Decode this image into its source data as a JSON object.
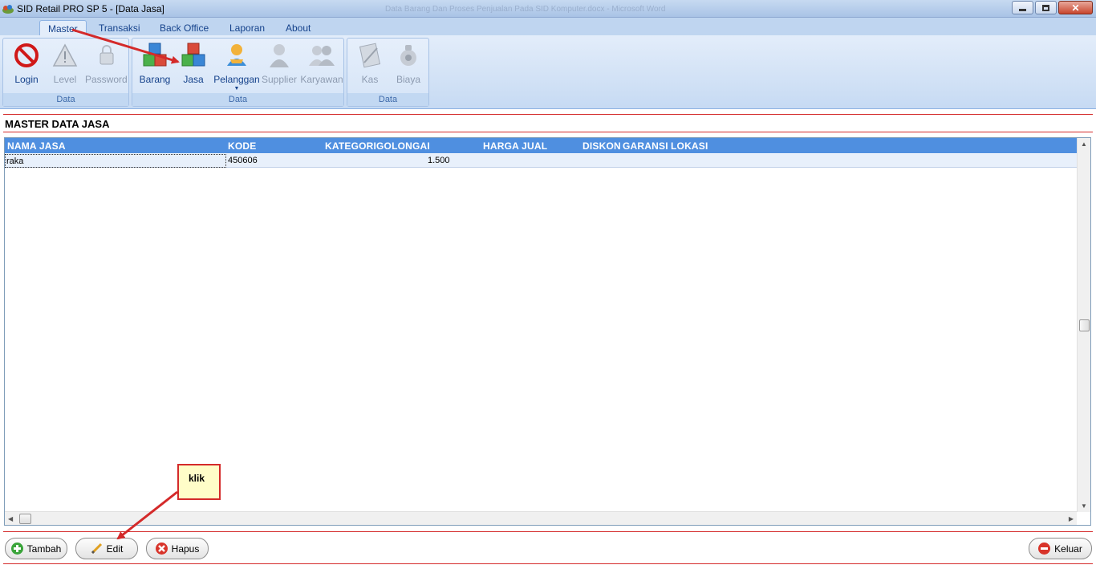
{
  "window": {
    "title": "SID Retail PRO SP 5 - [Data Jasa]",
    "background_ghost_text": "Data Barang Dan Proses Penjualan Pada SID Komputer.docx - Microsoft Word"
  },
  "ribbon": {
    "tabs": [
      {
        "label": "Master",
        "active": true
      },
      {
        "label": "Transaksi"
      },
      {
        "label": "Back Office"
      },
      {
        "label": "Laporan"
      },
      {
        "label": "About"
      }
    ],
    "groups": [
      {
        "label": "Data",
        "buttons": [
          {
            "label": "Login",
            "icon": "no-entry-icon",
            "enabled": true
          },
          {
            "label": "Level",
            "icon": "warning-icon",
            "enabled": false
          },
          {
            "label": "Password",
            "icon": "lock-icon",
            "enabled": false
          }
        ]
      },
      {
        "label": "Data",
        "buttons": [
          {
            "label": "Barang",
            "icon": "cubes-icon",
            "enabled": true
          },
          {
            "label": "Jasa",
            "icon": "cubes-red-icon",
            "enabled": true
          },
          {
            "label": "Pelanggan",
            "icon": "customer-icon",
            "enabled": true
          },
          {
            "label": "Supplier",
            "icon": "supplier-icon",
            "enabled": false
          },
          {
            "label": "Karyawan",
            "icon": "employees-icon",
            "enabled": false
          }
        ]
      },
      {
        "label": "Data",
        "buttons": [
          {
            "label": "Kas",
            "icon": "cash-book-icon",
            "enabled": false
          },
          {
            "label": "Biaya",
            "icon": "money-bag-icon",
            "enabled": false
          }
        ]
      }
    ]
  },
  "page": {
    "title": "MASTER DATA JASA"
  },
  "grid": {
    "columns": [
      "NAMA JASA",
      "KODE",
      "KATEGORI",
      "GOLONGAI",
      "HARGA JUAL",
      "DISKON",
      "GARANSI",
      "LOKASI"
    ],
    "rows": [
      {
        "nama": "raka",
        "kode": "450606",
        "harga": "1.500"
      }
    ]
  },
  "buttons": {
    "tambah": "Tambah",
    "edit": "Edit",
    "hapus": "Hapus",
    "keluar": "Keluar"
  },
  "annotation": {
    "callout": "klik"
  },
  "colors": {
    "accent": "#4f8fe0",
    "annotation_red": "#d42a2a",
    "ribbon_bg": "#dae7f8"
  }
}
